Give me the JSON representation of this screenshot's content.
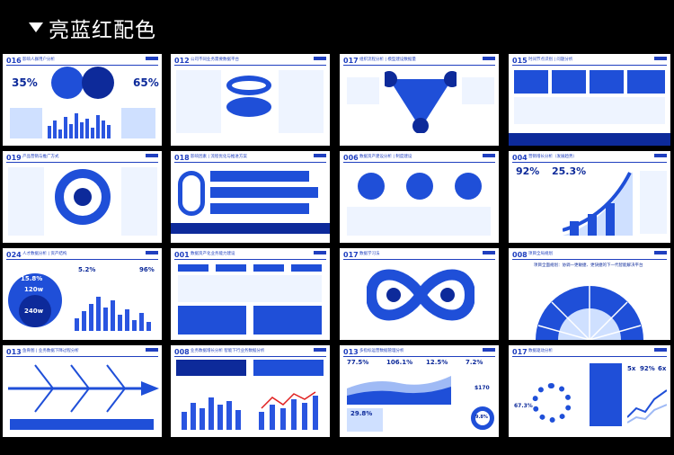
{
  "header": {
    "title": "亮蓝红配色"
  },
  "slides": [
    {
      "num": "016",
      "title": "影响人群用户分析",
      "stats": [
        "35%",
        "65%"
      ]
    },
    {
      "num": "012",
      "title": "公司不同业务需要数据平台"
    },
    {
      "num": "017",
      "title": "组织流程分析 | 模型建设数据量"
    },
    {
      "num": "015",
      "title": "时间节点识别 | 问题分析"
    },
    {
      "num": "019",
      "title": "产品营销与推广方式"
    },
    {
      "num": "018",
      "title": "影响因素 | 流程优化与推进方案"
    },
    {
      "num": "006",
      "title": "数据资产建设分析 | 制度建设"
    },
    {
      "num": "004",
      "title": "营销增长分析（发展趋势）",
      "stats": [
        "92%",
        "25.3%"
      ]
    },
    {
      "num": "024",
      "title": "人才数据分析 | 资产结构",
      "stats": [
        "15.8%",
        "120w",
        "240w",
        "5.2%",
        "96%"
      ]
    },
    {
      "num": "001",
      "title": "数据资产化业务能力建设"
    },
    {
      "num": "017",
      "title": "数据学习法"
    },
    {
      "num": "008",
      "title": "项目全局规划",
      "sub": "项目全面规划：协调一更敏捷、更快捷的下一代智能解决平台"
    },
    {
      "num": "013",
      "title": "鱼骨图 | 业务数据下降过程分析"
    },
    {
      "num": "008",
      "title": "业务数据增长分析 智能下行业务数据分析"
    },
    {
      "num": "013",
      "title": "多指标运营数据管理分析",
      "stats": [
        "77.5%",
        "106.1%",
        "12.5%",
        "7.2%",
        "29.8%",
        "$170",
        "9.8%"
      ]
    },
    {
      "num": "017",
      "title": "数据驱动分析",
      "stats": [
        "5x",
        "92%",
        "6x",
        "67.3%"
      ]
    }
  ]
}
